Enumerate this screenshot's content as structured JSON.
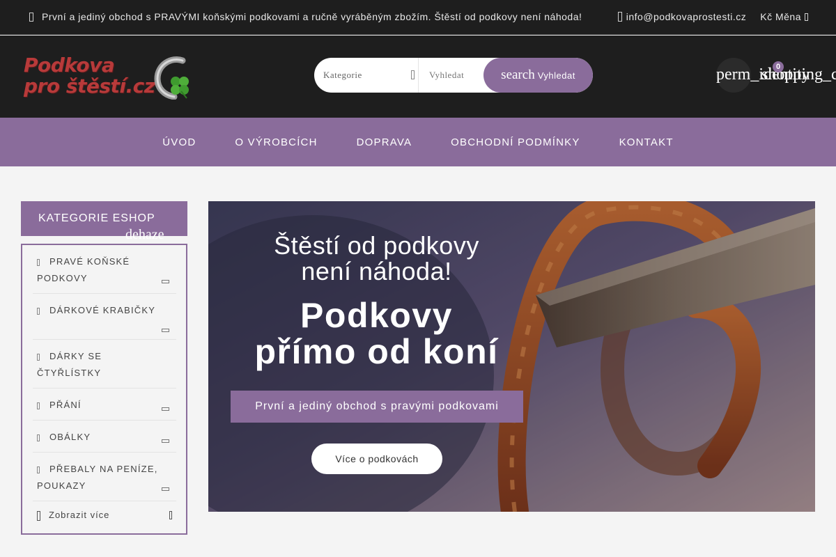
{
  "topbar": {
    "promo": "První a jediný obchod s PRAVÝMI koňskými podkovami a ručně vyráběným zbožím. Štěstí od podkovy není náhoda!",
    "email": "info@podkovaprostesti.cz",
    "currency_symbol": "Kč",
    "currency_label": "Měna"
  },
  "logo": {
    "line1": "Podkova",
    "line2": "pro štěstí.cz"
  },
  "search": {
    "category_label": "Kategorie",
    "placeholder": "Vyhledat",
    "button_icon_text": "search",
    "button_label": "Vyhledat"
  },
  "header_icons": {
    "account_text": "perm_identity",
    "cart_text": "shopping_cart",
    "cart_count": "0"
  },
  "nav": {
    "items": [
      "ÚVOD",
      "O VÝROBCÍCH",
      "DOPRAVA",
      "OBCHODNÍ PODMÍNKY",
      "KONTAKT"
    ]
  },
  "sidebar": {
    "title": "KATEGORIE ESHOP",
    "toggle_text": "dehaze",
    "categories": [
      {
        "line1": "PRAVÉ KOŇSKÉ",
        "line2": "PODKOVY"
      },
      {
        "line1": "DÁRKOVÉ KRABIČKY",
        "line2": ""
      },
      {
        "line1": "DÁRKY SE",
        "line2": "ČTYŘLÍSTKY"
      },
      {
        "line1": "PŘÁNÍ",
        "line2": ""
      },
      {
        "line1": "OBÁLKY",
        "line2": ""
      },
      {
        "line1": "PŘEBALY NA PENÍZE,",
        "line2": "POUKAZY"
      }
    ],
    "more_label": "Zobrazit více"
  },
  "hero": {
    "headline_1": "Štěstí od podkovy",
    "headline_2": "není náhoda!",
    "title_1": "Podkovy",
    "title_2": "přímo od koní",
    "tagline": "První a jediný obchod s pravými podkovami",
    "cta_label": "Více o podkovách"
  },
  "colors": {
    "accent": "#8a6c9b",
    "dark": "#1e1e1e",
    "logo_red": "#b83a3a"
  }
}
